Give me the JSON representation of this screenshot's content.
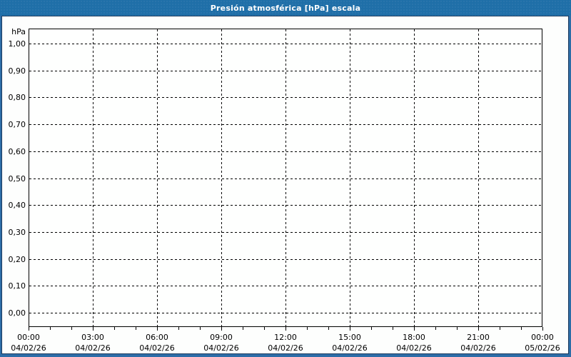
{
  "window": {
    "title": "Presión atmosférica [hPa] escala"
  },
  "colors": {
    "title_bar_bg": "#1f6fa8",
    "title_text": "#ffffff",
    "frame_outer": "#2d6da7",
    "frame_inner_line": "#1e3c5f",
    "content_bg": "#fdfefd",
    "plot_bg": "#fefffe",
    "axis_line": "#000000",
    "grid_line": "#000000",
    "label_text": "#000000"
  },
  "chart_data": {
    "type": "line",
    "title": "Presión atmosférica [hPa] escala",
    "unit_label": "hPa",
    "ylabel": "hPa",
    "ylim": [
      0.0,
      1.0
    ],
    "y_tick_step": 0.1,
    "y_tick_labels": [
      "1,00",
      "0,90",
      "0,80",
      "0,70",
      "0,60",
      "0,50",
      "0,40",
      "0,30",
      "0,20",
      "0,10",
      "0,00"
    ],
    "x_axis": {
      "range_hours": 24,
      "major_interval_hours": 3,
      "minor_interval_hours": 1,
      "major_ticks": [
        {
          "time": "00:00",
          "date": "04/02/26"
        },
        {
          "time": "03:00",
          "date": "04/02/26"
        },
        {
          "time": "06:00",
          "date": "04/02/26"
        },
        {
          "time": "09:00",
          "date": "04/02/26"
        },
        {
          "time": "12:00",
          "date": "04/02/26"
        },
        {
          "time": "15:00",
          "date": "04/02/26"
        },
        {
          "time": "18:00",
          "date": "04/02/26"
        },
        {
          "time": "21:00",
          "date": "04/02/26"
        },
        {
          "time": "00:00",
          "date": "05/02/26"
        }
      ]
    },
    "grid": "dashed",
    "legend": "none",
    "series": []
  }
}
